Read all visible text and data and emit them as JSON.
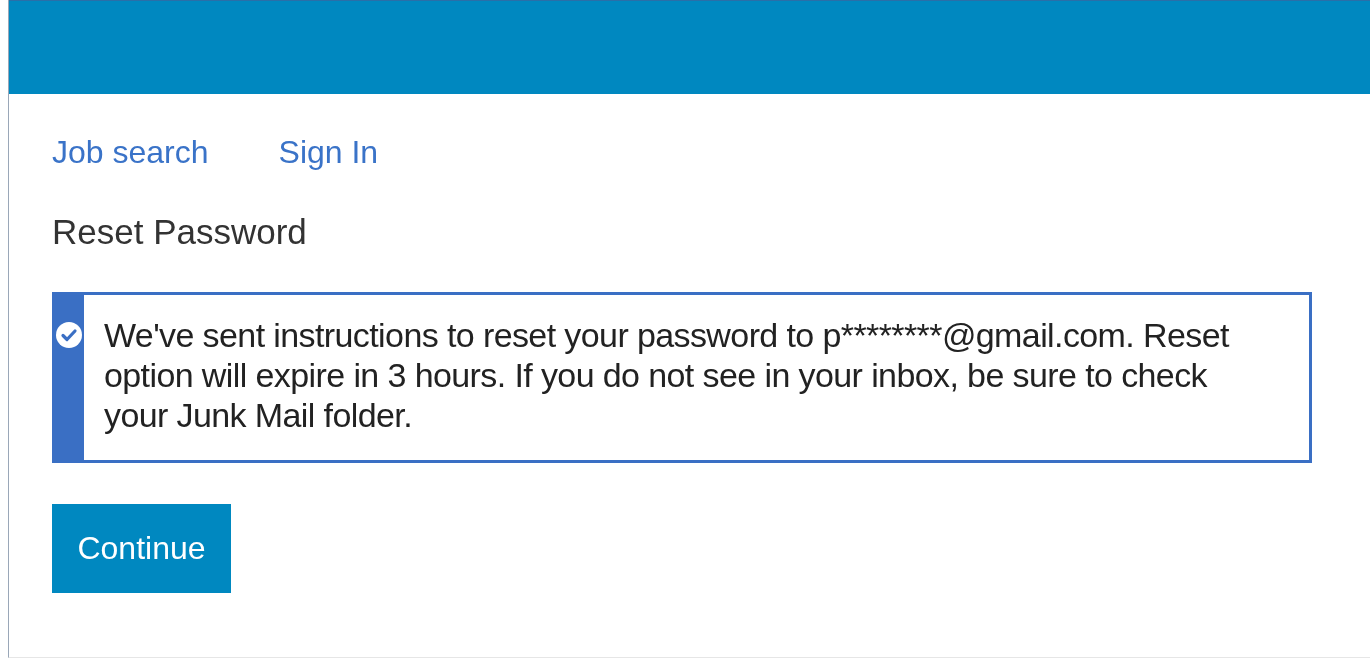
{
  "nav": [
    {
      "label": "Job search"
    },
    {
      "label": "Sign In"
    }
  ],
  "heading": "Reset Password",
  "alert": {
    "kind": "success",
    "message": "We've sent instructions to reset your password to p********@gmail.com. Reset option will expire in 3 hours. If you do not see in your inbox, be sure to check your Junk Mail folder."
  },
  "button": "Continue"
}
